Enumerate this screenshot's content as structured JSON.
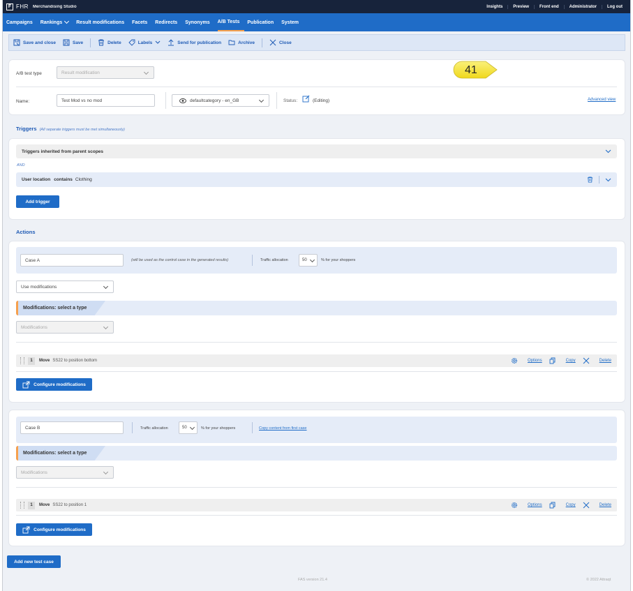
{
  "topbar": {
    "logo": "FHR",
    "studio": "Merchandising Studio",
    "links": [
      "Insights",
      "Preview",
      "Front end",
      "Administrator",
      "Log out"
    ]
  },
  "mainnav": {
    "items": [
      "Campaigns",
      "Rankings",
      "Result modifications",
      "Facets",
      "Redirects",
      "Synonyms",
      "A/B Tests",
      "Publication",
      "System"
    ],
    "active": "A/B Tests"
  },
  "toolbar": {
    "save_close": "Save and close",
    "save": "Save",
    "delete": "Delete",
    "labels": "Labels",
    "send": "Send for publication",
    "archive": "Archive",
    "close": "Close"
  },
  "callout": {
    "number": "41"
  },
  "header": {
    "type_label": "A/B test type",
    "type_value": "Result modification",
    "name_label": "Name:",
    "name_value": "Test Mod vs no mod",
    "scope_value": "defaultcategory - en_GB",
    "status_label": "Status:",
    "status_value": "(Editing)",
    "advanced_view": "Advanced view"
  },
  "triggers": {
    "title": "Triggers",
    "note": "(All separate triggers must be met simultaneously)",
    "inherited": "Triggers inherited from parent scopes",
    "and": "AND",
    "trigger_attr": "User location",
    "trigger_op": "contains",
    "trigger_val": "Clothing",
    "add_trigger": "Add trigger"
  },
  "actions": {
    "title": "Actions",
    "case_a": {
      "name": "Case A",
      "note": "(will be used as the control case in the generated results)",
      "traffic_label": "Traffic allocation",
      "traffic_value": "50",
      "traffic_suffix": "% for your shoppers",
      "use_mods": "Use modifications",
      "mod_type_title": "Modifications: select a type",
      "mod_select": "Modifications",
      "row_num": "1",
      "row_action": "Move",
      "row_text": "SS22  to position bottom",
      "options": "Options",
      "copy": "Copy",
      "delete": "Delete",
      "configure": "Configure modifications"
    },
    "case_b": {
      "name": "Case B",
      "traffic_label": "Traffic allocation",
      "traffic_value": "50",
      "traffic_suffix": "% for your shoppers",
      "copy_content": "Copy content from first case",
      "mod_type_title": "Modifications: select a type",
      "mod_select": "Modifications",
      "row_num": "1",
      "row_action": "Move",
      "row_text": "SS22  to position 1",
      "options": "Options",
      "copy": "Copy",
      "delete": "Delete",
      "configure": "Configure modifications"
    },
    "add_case": "Add new test case"
  },
  "footer": {
    "version": "FAS version 21.4",
    "copyright": "© 2022 Attraqt"
  },
  "colors": {
    "topbar": "#17233b",
    "nav": "#1f6cc7",
    "accent": "#f6a04d",
    "callout": "#f5e23a"
  }
}
